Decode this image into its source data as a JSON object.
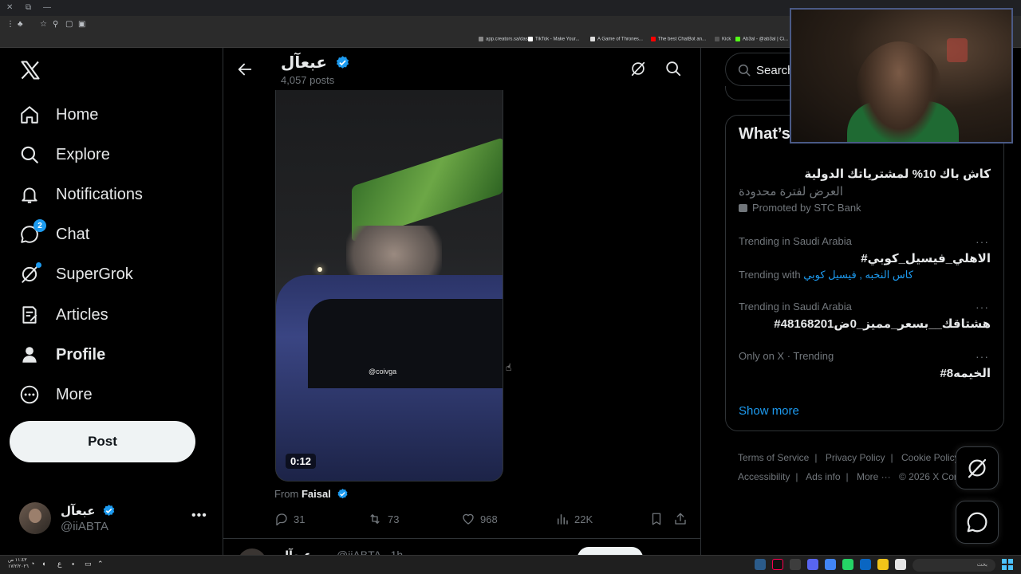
{
  "browser": {
    "bookmarks": [
      {
        "label": "app.creators.sa/das...",
        "color": "#888888"
      },
      {
        "label": "TikTok - Make Your...",
        "color": "#ffffff"
      },
      {
        "label": "A Game of Thrones...",
        "color": "#e0e0e0"
      },
      {
        "label": "The best ChatBot an...",
        "color": "#ff0000"
      },
      {
        "label": "Kick",
        "color": "#53fc18"
      },
      {
        "label": "Ab3al - @ab3al | Ci...",
        "color": "#cccccc"
      }
    ]
  },
  "nav": {
    "items": [
      {
        "label": "Home",
        "icon": "home-icon"
      },
      {
        "label": "Explore",
        "icon": "search-icon"
      },
      {
        "label": "Notifications",
        "icon": "bell-icon"
      },
      {
        "label": "Chat",
        "icon": "chat-icon",
        "badge": "2"
      },
      {
        "label": "SuperGrok",
        "icon": "grok-icon"
      },
      {
        "label": "Articles",
        "icon": "articles-icon"
      },
      {
        "label": "Profile",
        "icon": "person-icon"
      },
      {
        "label": "More",
        "icon": "more-circle-icon"
      }
    ],
    "post_label": "Post",
    "account": {
      "name": "عبعآل",
      "handle": "@iiABTA"
    }
  },
  "header": {
    "name": "عبعآل",
    "posts": "4,057 posts"
  },
  "post": {
    "video": {
      "timecode": "0:12",
      "watermark": "@coivga"
    },
    "from_prefix": "From",
    "from_name": "Faisal",
    "actions": {
      "replies": "31",
      "reposts": "73",
      "likes": "968",
      "views": "22K"
    }
  },
  "next_post": {
    "name": "عبعآل",
    "handle": "@iiABTA · 1h",
    "button": "Repost"
  },
  "right": {
    "search_placeholder": "Search",
    "trends_title": "What’s happening",
    "promo": {
      "title": "كاش باك 10% لمشترياتك الدولية",
      "subtitle": "العرض لفترة محدودة",
      "by": "Promoted by STC Bank"
    },
    "trends": [
      {
        "context": "Trending in Saudi Arabia",
        "name": "#الاهلي_فيسيل_كوبي",
        "with_prefix": "Trending with",
        "with_links": "كاس النخبه , فيسيل كوبي"
      },
      {
        "context": "Trending in Saudi Arabia",
        "name": "#هشتاقك__بسعر_مميز_0ض48168201"
      },
      {
        "context": "Only on X · Trending",
        "name": "#الخيمه8"
      }
    ],
    "show_more": "Show more",
    "footer": [
      "Terms of Service",
      "Privacy Policy",
      "Cookie Policy",
      "Accessibility",
      "Ads info",
      "More ···",
      "© 2026 X Corp."
    ]
  },
  "taskbar": {
    "search_label": "بحث",
    "time": "١١:٤٣ ص",
    "date": "١٧/٢/٢٠٢٦"
  },
  "colors": {
    "accent": "#1d9bf0",
    "background": "#000000",
    "border": "#2f3336",
    "muted": "#71767b"
  }
}
